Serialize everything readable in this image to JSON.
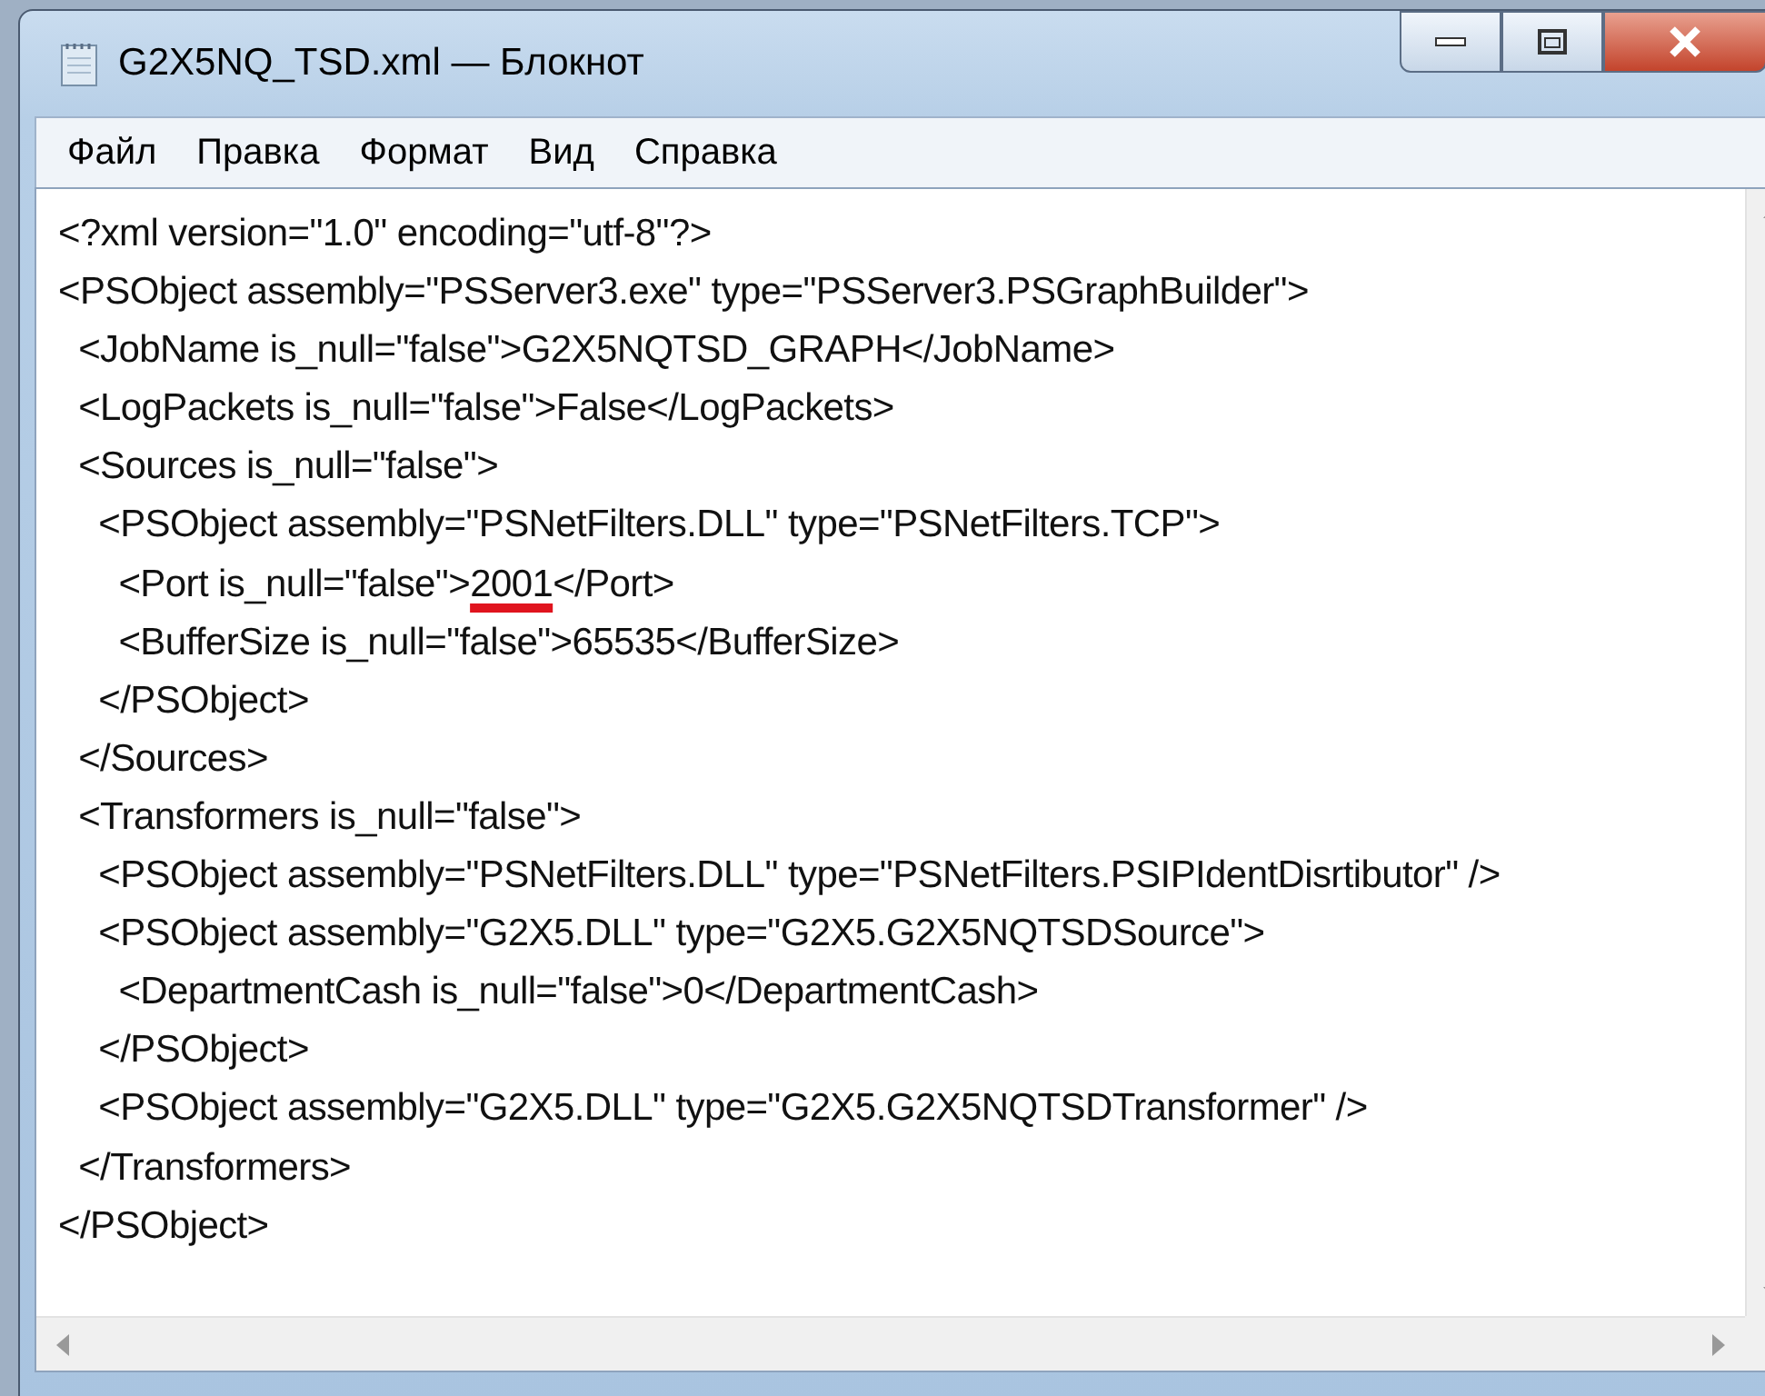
{
  "window": {
    "title": "G2X5NQ_TSD.xml — Блокнот"
  },
  "menu": [
    "Файл",
    "Правка",
    "Формат",
    "Вид",
    "Справка"
  ],
  "lines": [
    {
      "parts": [
        {
          "text": "<?xml version=\"1.0\" encoding=\"utf-8\"?>",
          "underlined": false
        }
      ]
    },
    {
      "parts": [
        {
          "text": "<PSObject assembly=\"PSServer3.exe\" type=\"PSServer3.PSGraphBuilder\">",
          "underlined": false
        }
      ]
    },
    {
      "parts": [
        {
          "text": "  <JobName is_null=\"false\">G2X5NQTSD_GRAPH</JobName>",
          "underlined": false
        }
      ]
    },
    {
      "parts": [
        {
          "text": "  <LogPackets is_null=\"false\">False</LogPackets>",
          "underlined": false
        }
      ]
    },
    {
      "parts": [
        {
          "text": "  <Sources is_null=\"false\">",
          "underlined": false
        }
      ]
    },
    {
      "parts": [
        {
          "text": "    <PSObject assembly=\"PSNetFilters.DLL\" type=\"PSNetFilters.TCP\">",
          "underlined": false
        }
      ]
    },
    {
      "parts": [
        {
          "text": "      <Port is_null=\"false\">",
          "underlined": false
        },
        {
          "text": "2001",
          "underlined": true
        },
        {
          "text": "</Port>",
          "underlined": false
        }
      ]
    },
    {
      "parts": [
        {
          "text": "      <BufferSize is_null=\"false\">65535</BufferSize>",
          "underlined": false
        }
      ]
    },
    {
      "parts": [
        {
          "text": "    </PSObject>",
          "underlined": false
        }
      ]
    },
    {
      "parts": [
        {
          "text": "  </Sources>",
          "underlined": false
        }
      ]
    },
    {
      "parts": [
        {
          "text": "  <Transformers is_null=\"false\">",
          "underlined": false
        }
      ]
    },
    {
      "parts": [
        {
          "text": "    <PSObject assembly=\"PSNetFilters.DLL\" type=\"PSNetFilters.PSIPIdentDisrtibutor\" />",
          "underlined": false
        }
      ]
    },
    {
      "parts": [
        {
          "text": "    <PSObject assembly=\"G2X5.DLL\" type=\"G2X5.G2X5NQTSDSource\">",
          "underlined": false
        }
      ]
    },
    {
      "parts": [
        {
          "text": "      <DepartmentCash is_null=\"false\">0</DepartmentCash>",
          "underlined": false
        }
      ]
    },
    {
      "parts": [
        {
          "text": "    </PSObject>",
          "underlined": false
        }
      ]
    },
    {
      "parts": [
        {
          "text": "    <PSObject assembly=\"G2X5.DLL\" type=\"G2X5.G2X5NQTSDTransformer\" />",
          "underlined": false
        }
      ]
    },
    {
      "parts": [
        {
          "text": "  </Transformers>",
          "underlined": false
        }
      ]
    },
    {
      "parts": [
        {
          "text": "</PSObject>",
          "underlined": false
        }
      ]
    }
  ]
}
